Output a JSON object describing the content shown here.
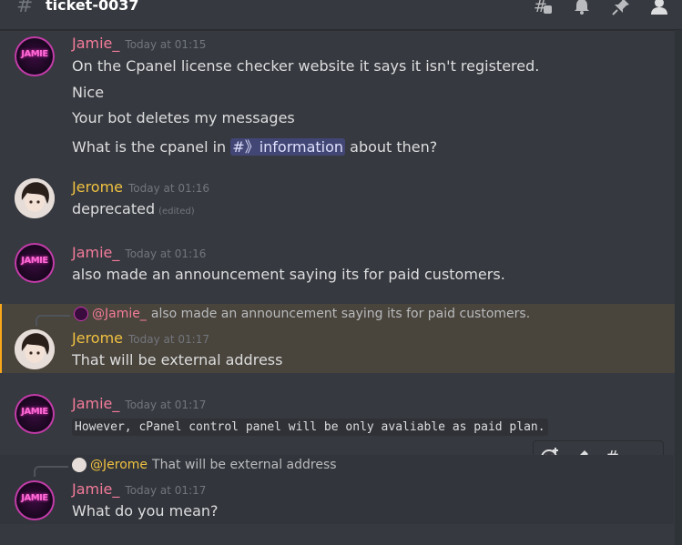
{
  "channel": {
    "name": "ticket-0037"
  },
  "colors": {
    "background": "#36393f",
    "jamie": "#f47b9a",
    "jerome": "#f0c141",
    "mention_bg": "#414675",
    "highlight_bg": "#49443c",
    "highlight_border": "#faa81a"
  },
  "icons": {
    "header": [
      "threads-icon",
      "bell-icon",
      "pin-icon",
      "members-icon"
    ],
    "hover_toolbar": [
      "add-reaction-icon",
      "edit-icon",
      "create-thread-icon",
      "more-icon"
    ]
  },
  "messages": [
    {
      "author": "Jamie_",
      "avatar_text": "JAMIE",
      "time": "Today at 01:15",
      "lines": [
        "On the Cpanel license checker website it says it isn't registered.",
        "Nice",
        "Your bot deletes my messages"
      ],
      "last_line": {
        "before": "What is the cpanel in ",
        "mention": "#》information",
        "after": " about then?"
      }
    },
    {
      "author": "Jerome",
      "time": "Today at 01:16",
      "text": "deprecated",
      "edited": "(edited)"
    },
    {
      "author": "Jamie_",
      "avatar_text": "JAMIE",
      "time": "Today at 01:16",
      "text": "also made an announcement saying its for paid customers."
    },
    {
      "reply_to": {
        "author": "@Jamie_",
        "text": "also made an announcement saying its for paid customers."
      },
      "author": "Jerome",
      "time": "Today at 01:17",
      "text": "That will be external address"
    },
    {
      "author": "Jamie_",
      "avatar_text": "JAMIE",
      "time": "Today at 01:17",
      "code": "However, cPanel control panel will be only avaliable as paid plan."
    },
    {
      "reply_to": {
        "author": "@Jerome",
        "text": "That will be external address"
      },
      "author": "Jamie_",
      "avatar_text": "JAMIE",
      "time": "Today at 01:17",
      "text": "What do you mean?"
    }
  ]
}
